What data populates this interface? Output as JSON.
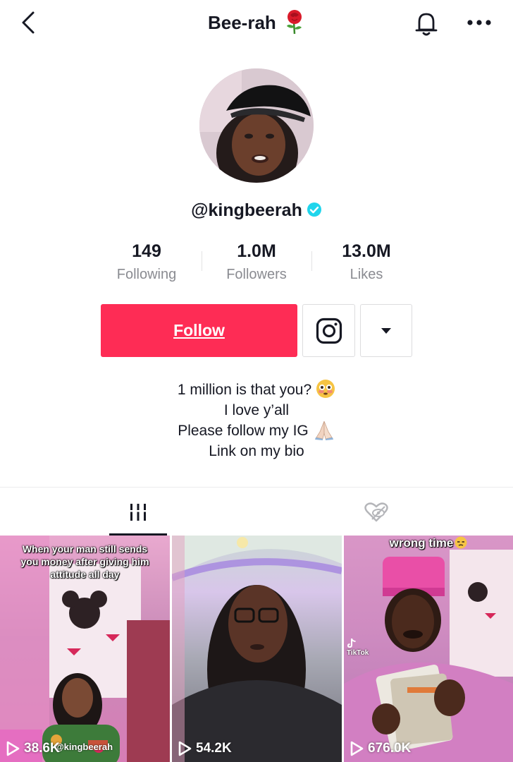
{
  "header": {
    "title": "Bee-rah",
    "title_emoji": "rose-emoji"
  },
  "profile": {
    "handle": "@kingbeerah",
    "verified": true
  },
  "stats": [
    {
      "value": "149",
      "label": "Following"
    },
    {
      "value": "1.0M",
      "label": "Followers"
    },
    {
      "value": "13.0M",
      "label": "Likes"
    }
  ],
  "actions": {
    "follow_label": "Follow",
    "instagram_icon": "instagram-icon",
    "dropdown_icon": "caret-down-icon"
  },
  "bio": {
    "line1": "1 million is that you?",
    "line2": "I love y’all",
    "line3": "Please follow my IG",
    "line4": "Link on my bio"
  },
  "tabs": [
    {
      "name": "videos",
      "icon": "grid-bars-icon",
      "active": true
    },
    {
      "name": "liked",
      "icon": "hidden-heart-icon",
      "active": false
    }
  ],
  "videos": [
    {
      "caption": "When your man still sends you money after giving him attitude all day",
      "views": "38.6K",
      "watermark": "@kingbeerah"
    },
    {
      "caption": "",
      "views": "54.2K"
    },
    {
      "caption": "wrong time",
      "views": "676.0K",
      "watermark": "TikTok"
    }
  ],
  "colors": {
    "follow": "#fe2c55",
    "verified": "#20d5ec",
    "text": "#161823",
    "muted": "#8a8b91"
  }
}
